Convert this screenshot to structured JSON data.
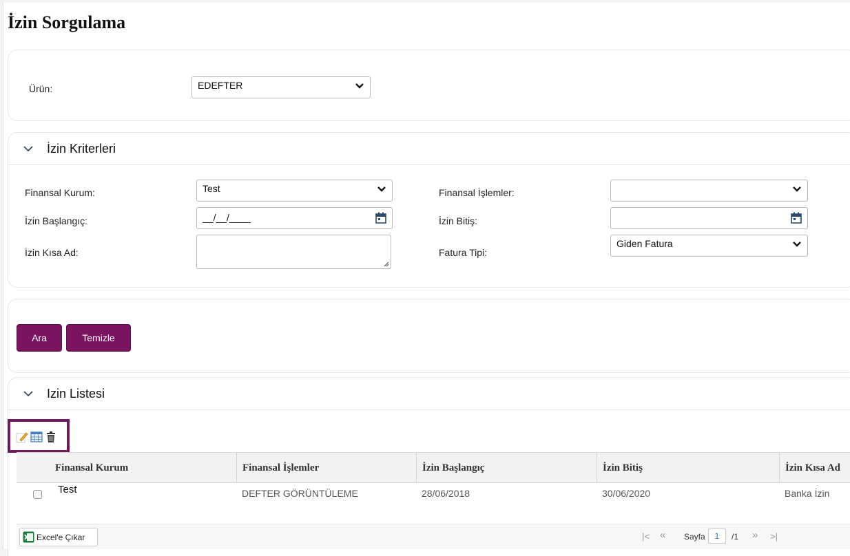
{
  "page": {
    "title": "İzin Sorgulama"
  },
  "urun": {
    "label": "Ürün:",
    "value": "EDEFTER"
  },
  "criteria": {
    "header": "İzin Kriterleri",
    "finansal_kurum": {
      "label": "Finansal Kurum:",
      "value": "Test"
    },
    "finansal_islemler": {
      "label": "Finansal İşlemler:",
      "value": ""
    },
    "izin_baslangic": {
      "label": "İzin Başlangıç:",
      "value": "__/__/____"
    },
    "izin_bitis": {
      "label": "İzin Bitiş:",
      "value": ""
    },
    "izin_kisa_ad": {
      "label": "İzin Kısa Ad:",
      "value": ""
    },
    "fatura_tipi": {
      "label": "Fatura Tipi:",
      "value": "Giden Fatura"
    }
  },
  "actions": {
    "search": "Ara",
    "clear": "Temizle"
  },
  "list": {
    "header": "Izin Listesi",
    "toolbar_icons": [
      "edit-icon",
      "table-view-icon",
      "delete-icon"
    ],
    "columns": [
      "Finansal Kurum",
      "Finansal İşlemler",
      "İzin Başlangıç",
      "İzin Bitiş",
      "İzin Kısa Ad"
    ],
    "rows": [
      [
        "Test",
        "DEFTER GÖRÜNTÜLEME",
        "28/06/2018",
        "30/06/2020",
        "Banka İzin"
      ]
    ]
  },
  "footer": {
    "excel_label": "Excel'e Çıkar",
    "page_label": "Sayfa",
    "current_page": "1",
    "total_pages": "/1",
    "first_symbol": "|<",
    "prev_symbol": "«",
    "next_symbol": "»",
    "last_symbol": ">|"
  },
  "colors": {
    "accent": "#7b1460",
    "toolbox_border": "#6f1a5c"
  }
}
